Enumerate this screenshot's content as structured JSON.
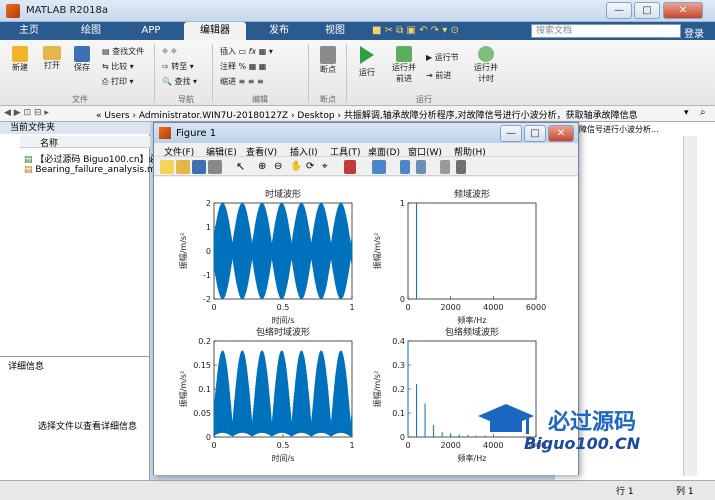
{
  "window": {
    "title": "MATLAB R2018a"
  },
  "tabs": [
    "主页",
    "绘图",
    "APP",
    "编辑器",
    "发布",
    "视图"
  ],
  "active_tab": "编辑器",
  "search": {
    "placeholder": "搜索文档"
  },
  "login_label": "登录",
  "ribbon": {
    "new_label": "新建",
    "open_label": "打开",
    "save_label": "保存",
    "find_files_label": "查找文件",
    "compare_label": "比较",
    "print_label": "打印",
    "goto_label": "转至",
    "find_label": "查找",
    "insert_label": "插入",
    "comment_label": "注释",
    "indent_label": "缩进",
    "breakpoints_label": "断点",
    "run_label": "运行",
    "run_advance_label": "运行并\n前进",
    "run_section_label": "运行节",
    "advance_label": "前进",
    "run_time_label": "运行并\n计时",
    "groups": {
      "file": "文件",
      "nav": "导航",
      "edit": "编辑",
      "breakpoints": "断点",
      "run": "运行"
    }
  },
  "address": {
    "path": "« Users › Administrator.WIN7U-20180127Z › Desktop › 共振解调,轴承故障分析程序,对故障信号进行小波分析，获取轴承故障信息"
  },
  "current_folder": {
    "header": "当前文件夹",
    "column_name": "名称",
    "files": [
      "【必过源码 Biguo100.cn】必",
      "Bearing_failure_analysis.m"
    ]
  },
  "details": {
    "header": "详细信息",
    "hint": "选择文件以查看详细信息"
  },
  "right_panel_snippet": "障信号进行小波分析...",
  "statusbar": {
    "row_label": "行",
    "row": "1",
    "col_label": "列",
    "col": "1"
  },
  "figure": {
    "title": "Figure 1",
    "menu": [
      "文件(F)",
      "编辑(E)",
      "查看(V)",
      "插入(I)",
      "工具(T)",
      "桌面(D)",
      "窗口(W)",
      "帮助(H)"
    ]
  },
  "watermark": {
    "line1": "必过源码",
    "line2": "Biguo100.CN"
  },
  "chart_data": [
    {
      "type": "line",
      "title": "时域波形",
      "xlabel": "时间/s",
      "ylabel": "振幅/m/s²",
      "xlim": [
        0,
        1
      ],
      "ylim": [
        -2,
        2
      ],
      "xticks": [
        "0",
        "0.5",
        "1"
      ],
      "yticks": [
        "-2",
        "-1",
        "0",
        "1",
        "2"
      ],
      "series": [
        {
          "desc": "amplitude-modulated signal, envelope peaks ~2 with 7 lobes",
          "envelope_peaks": 7,
          "max_amplitude": 2
        }
      ]
    },
    {
      "type": "line",
      "title": "频域波形",
      "xlabel": "频率/Hz",
      "ylabel": "振幅/m/s²",
      "xlim": [
        0,
        6000
      ],
      "ylim": [
        0,
        1
      ],
      "xticks": [
        "0",
        "2000",
        "4000",
        "6000"
      ],
      "series": [
        {
          "peaks": [
            {
              "x": 400,
              "y": 1.0
            }
          ]
        }
      ]
    },
    {
      "type": "line",
      "title": "包络时域波形",
      "xlabel": "时间/s",
      "ylabel": "振幅/m/s²",
      "xlim": [
        0,
        1
      ],
      "ylim": [
        0,
        0.2
      ],
      "xticks": [
        "0",
        "0.5",
        "1"
      ],
      "yticks": [
        "0",
        "0.05",
        "0.1",
        "0.15",
        "0.2"
      ],
      "series": [
        {
          "envelope_peaks": 7,
          "max_amplitude": 0.18
        }
      ]
    },
    {
      "type": "bar",
      "title": "包络频域波形",
      "xlabel": "频率/Hz",
      "ylabel": "振幅/m/s²",
      "xlim": [
        0,
        6000
      ],
      "ylim": [
        0,
        0.4
      ],
      "xticks": [
        "0",
        "2000",
        "4000",
        "6000"
      ],
      "yticks": [
        "0",
        "0.1",
        "0.2",
        "0.3",
        "0.4"
      ],
      "series": [
        {
          "x": [
            0,
            400,
            800,
            1200,
            1600,
            2000,
            2400,
            2800,
            3200,
            3600,
            4000,
            4400,
            4800
          ],
          "y": [
            0.4,
            0.22,
            0.14,
            0.05,
            0.02,
            0.015,
            0.01,
            0.008,
            0.006,
            0.005,
            0.004,
            0.003,
            0.003
          ]
        }
      ]
    }
  ]
}
